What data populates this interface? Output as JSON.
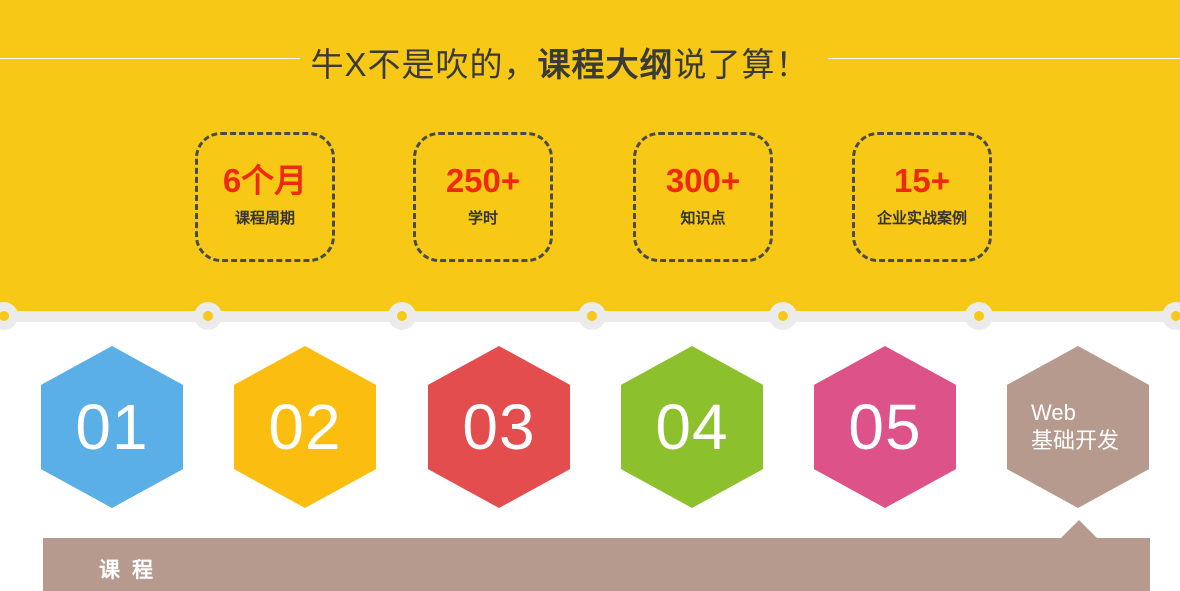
{
  "header": {
    "title_pre": "牛X不是吹的，",
    "title_bold": "课程大纲",
    "title_post": "说了算！"
  },
  "stats": [
    {
      "value": "6个月",
      "label": "课程周期"
    },
    {
      "value": "250+",
      "label": "学时"
    },
    {
      "value": "300+",
      "label": "知识点"
    },
    {
      "value": "15+",
      "label": "企业实战案例"
    }
  ],
  "modules": [
    {
      "number": "01",
      "color": "#5ab0e6"
    },
    {
      "number": "02",
      "color": "#fbbd0f"
    },
    {
      "number": "03",
      "color": "#e34d4d"
    },
    {
      "number": "04",
      "color": "#8cc02d"
    },
    {
      "number": "05",
      "color": "#dd5289"
    },
    {
      "line1": "Web",
      "line2": "基础开发",
      "color": "#b59a8d"
    }
  ],
  "course_bar": {
    "label": "课程"
  },
  "colors": {
    "background_top": "#f7c916",
    "accent_number": "#ee2a0a",
    "bar": "#b59a8d"
  }
}
